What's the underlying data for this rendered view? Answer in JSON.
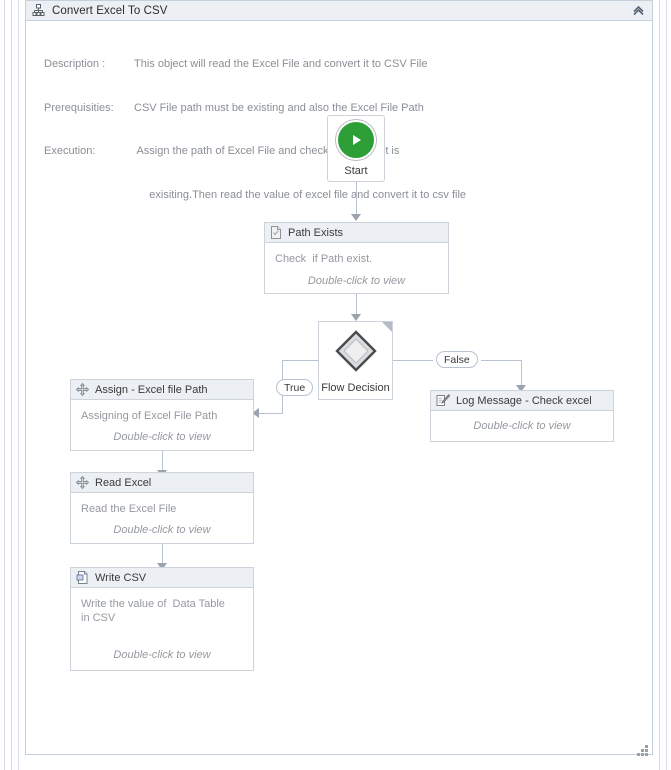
{
  "window": {
    "title": "Convert Excel To CSV",
    "title_icon": "sitemap-icon",
    "collapse_icon": "double-chevron-up-icon",
    "resize_grip_icon": "resize-grip-icon"
  },
  "description_block": {
    "rows": [
      {
        "label": "Description :",
        "value": "This object will read the Excel File and convert it to CSV File"
      },
      {
        "label": "Prerequisities:",
        "value": "CSV File path must be existing and also the Excel File Path"
      },
      {
        "label": "Execution:",
        "value": " Assign the path of Excel File and check the path if it is"
      }
    ],
    "continuation": "     exisiting.Then read the value of excel file and convert it to csv file"
  },
  "flowchart": {
    "start": {
      "label": "Start",
      "icon": "play-icon",
      "accent": "#2e9e36"
    },
    "nodes": [
      {
        "id": "path-exists",
        "title": "Path Exists",
        "icon": "file-check-icon",
        "description": "Check  if Path exist.",
        "hint": "Double-click to view"
      },
      {
        "id": "assign-excel-file-path",
        "title": "Assign - Excel file Path",
        "icon": "assign-icon",
        "description": "Assigning of Excel File Path",
        "hint": "Double-click to view"
      },
      {
        "id": "read-excel",
        "title": "Read Excel",
        "icon": "assign-icon",
        "description": "Read the Excel File",
        "hint": "Double-click to view"
      },
      {
        "id": "write-csv",
        "title": "Write CSV",
        "icon": "write-file-icon",
        "description": "Write the value of  Data Table in CSV",
        "hint": "Double-click to view"
      },
      {
        "id": "log-message",
        "title": "Log Message - Check excel",
        "icon": "log-message-icon",
        "description": "",
        "hint": "Double-click to view"
      }
    ],
    "decision": {
      "title": "Flow Decision",
      "icon": "diamond-icon"
    },
    "branches": {
      "true_label": "True",
      "false_label": "False"
    }
  },
  "colors": {
    "start_green": "#2e9e36",
    "node_header": "#eceff3",
    "node_border": "#cdd3da",
    "connector": "#b9c2cf",
    "muted_text": "#95999f"
  }
}
